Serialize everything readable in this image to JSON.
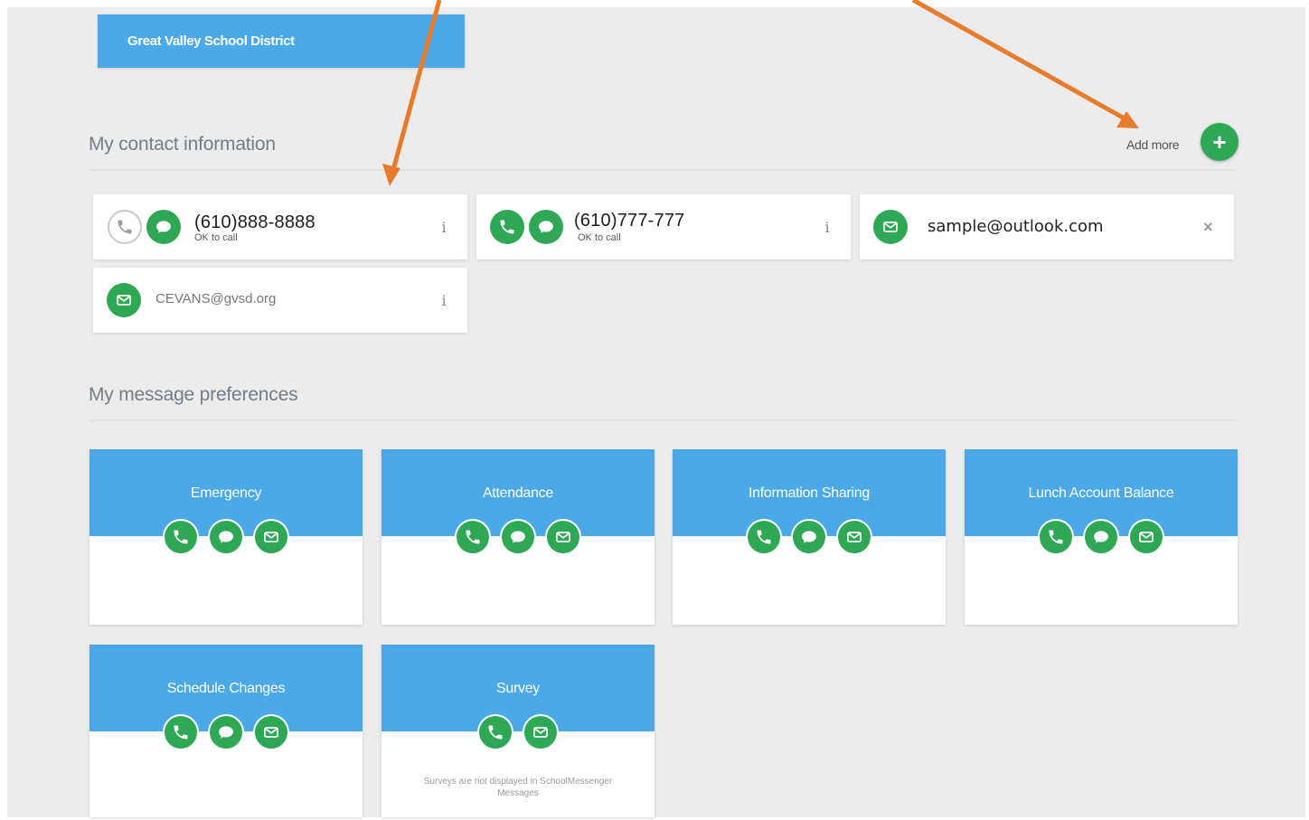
{
  "header": {
    "district_name": "Great Valley School District"
  },
  "contact_section": {
    "title": "My contact information",
    "add_more_label": "Add more",
    "add_button_glyph": "+",
    "contacts": [
      {
        "type": "phone",
        "value": "(610)888-8888",
        "status": "OK to call",
        "icons": [
          "phone-outline-icon",
          "sms-icon"
        ],
        "action": "i"
      },
      {
        "type": "phone",
        "value": "(610)777-777",
        "status": "OK to call",
        "icons": [
          "phone-icon",
          "sms-icon"
        ],
        "action": "i"
      },
      {
        "type": "email",
        "value": "sample@outlook.com",
        "icons": [
          "email-icon"
        ],
        "action": "×"
      },
      {
        "type": "email",
        "value": "CEVANS@gvsd.org",
        "icons": [
          "email-icon"
        ],
        "action": "i"
      }
    ]
  },
  "preferences_section": {
    "title": "My message preferences",
    "cards": [
      {
        "label": "Emergency",
        "channels": [
          "phone",
          "sms",
          "email"
        ]
      },
      {
        "label": "Attendance",
        "channels": [
          "phone",
          "sms",
          "email"
        ]
      },
      {
        "label": "Information Sharing",
        "channels": [
          "phone",
          "sms",
          "email"
        ]
      },
      {
        "label": "Lunch Account Balance",
        "channels": [
          "phone",
          "sms",
          "email"
        ]
      },
      {
        "label": "Schedule Changes",
        "channels": [
          "phone",
          "sms",
          "email"
        ]
      },
      {
        "label": "Survey",
        "channels": [
          "phone",
          "email"
        ],
        "note": "Surveys are not displayed in SchoolMessenger Messages"
      }
    ]
  },
  "colors": {
    "brand_blue": "#4aa9e6",
    "channel_green": "#2fa856",
    "annotation_arrow": "#e87b2c",
    "background": "#ececec"
  }
}
